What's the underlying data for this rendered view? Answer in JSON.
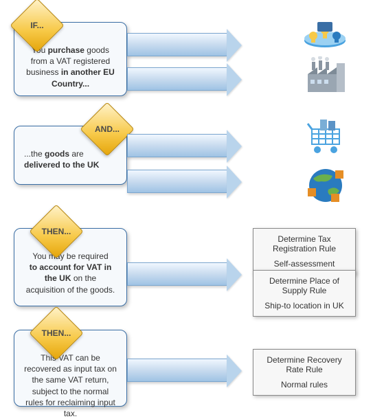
{
  "cards": {
    "if": {
      "label": "IF...",
      "text_pre": "You ",
      "text_b1": "purchase",
      "text_mid": " goods from a VAT registered business ",
      "text_b2": "in another EU Country...",
      "text_post": ""
    },
    "and": {
      "label": "AND...",
      "text_pre": "...the ",
      "text_b1": "goods",
      "text_mid": " are ",
      "text_b2": "delivered to the UK",
      "text_post": ""
    },
    "then1": {
      "label": "THEN...",
      "text_pre": "You may be required",
      "text_b1": "to account for VAT in the UK",
      "text_mid": " on the acquisition of the goods.",
      "text_b2": "",
      "text_post": ""
    },
    "then2": {
      "label": "THEN...",
      "text_full": "This VAT can be recovered as input tax on the same VAT return, subject to the normal rules for reclaiming input tax."
    }
  },
  "rules": {
    "tax_reg": {
      "title": "Determine Tax Registration Rule",
      "sub": "Self-assessment"
    },
    "supply": {
      "title": "Determine Place of Supply Rule",
      "sub": "Ship-to location in UK"
    },
    "recovery": {
      "title": "Determine Recovery Rate Rule",
      "sub": "Normal rules"
    }
  },
  "icons": {
    "people_circle": "people-circle-icon",
    "factory": "factory-icon",
    "cart": "shopping-cart-icon",
    "globe": "globe-boxes-icon"
  }
}
